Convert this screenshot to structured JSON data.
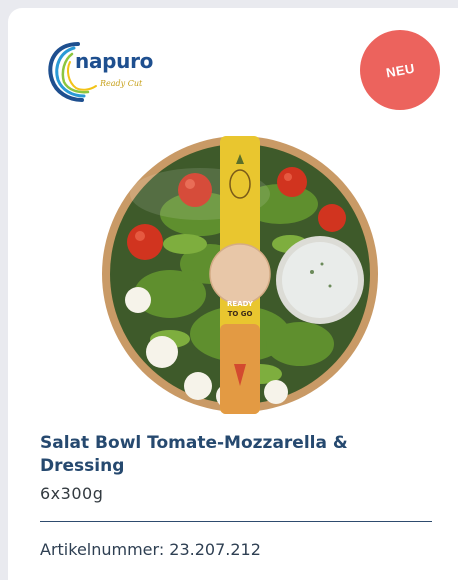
{
  "brand": {
    "name": "napuro",
    "tagline": "Ready Cut"
  },
  "badge": {
    "label": "NEU",
    "color": "#ec635d"
  },
  "product": {
    "title": "Salat Bowl Tomate-Mozzarella & Dressing",
    "package_size": "6x300g",
    "article_number_label": "Artikelnummer: 23.207.212",
    "label_text_top": "READY",
    "label_text_bottom": "TO GO"
  },
  "colors": {
    "title": "#26496f",
    "accent": "#ec635d"
  }
}
